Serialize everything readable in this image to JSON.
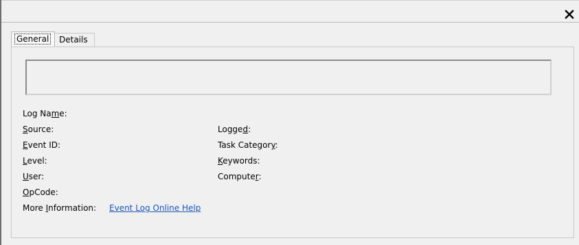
{
  "window": {
    "close_icon": "close-icon"
  },
  "tabs": [
    {
      "label": "General",
      "selected": true
    },
    {
      "label": "Details",
      "selected": false
    }
  ],
  "fields": {
    "log_name": {
      "pre": "Log Na",
      "accel": "m",
      "post": "e:"
    },
    "source": {
      "pre": "",
      "accel": "S",
      "post": "ource:"
    },
    "event_id": {
      "pre": "",
      "accel": "E",
      "post": "vent ID:"
    },
    "level": {
      "pre": "",
      "accel": "L",
      "post": "evel:"
    },
    "user": {
      "pre": "",
      "accel": "U",
      "post": "ser:"
    },
    "opcode": {
      "pre": "",
      "accel": "O",
      "post": "pCode:"
    },
    "more_info": {
      "pre": "More ",
      "accel": "I",
      "post": "nformation:"
    },
    "logged": {
      "pre": "Logge",
      "accel": "d",
      "post": ":"
    },
    "task_category": {
      "pre": "Task Categor",
      "accel": "y",
      "post": ":"
    },
    "keywords": {
      "pre": "",
      "accel": "K",
      "post": "eywords:"
    },
    "computer": {
      "pre": "Compute",
      "accel": "r",
      "post": ":"
    }
  },
  "help_link": "Event Log Online Help"
}
